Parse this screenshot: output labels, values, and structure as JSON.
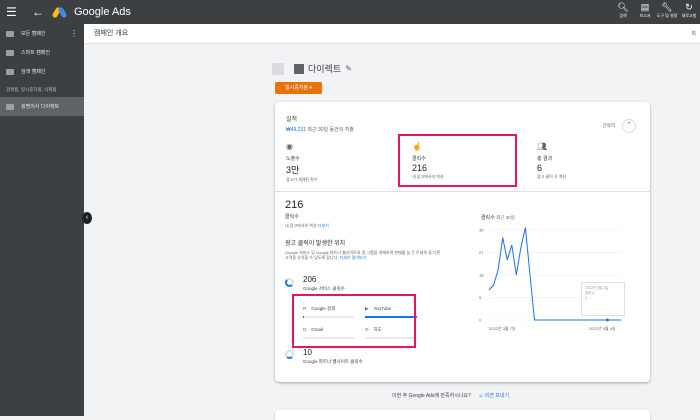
{
  "app": {
    "title": "Google Ads"
  },
  "colors": {
    "accent": "#1a73e8",
    "highlight": "#e8175d",
    "status": "#e8710a",
    "chrome": "#3c4043"
  },
  "toolbar": [
    {
      "icon": "search-icon",
      "label": "검색"
    },
    {
      "icon": "report-icon",
      "label": "보고서"
    },
    {
      "icon": "wrench-icon",
      "label": "도구 및 설정"
    },
    {
      "icon": "refresh-icon",
      "label": "새로고침"
    }
  ],
  "sidebar": {
    "items": [
      {
        "label": "모든 캠페인",
        "icon": "grid-icon"
      },
      {
        "label": "스마트 캠페인",
        "icon": "smart-campaign-icon"
      },
      {
        "label": "검색 캠페인",
        "icon": "search-campaign-icon"
      }
    ],
    "section_label": "검색됨, 일시중지됨, 삭제됨",
    "selected": {
      "label": "광명이사 다이렉트",
      "icon": "campaign-icon"
    }
  },
  "breadcrumb": {
    "title": "캠페인 개요",
    "more": "최"
  },
  "campaign": {
    "name": "다이렉트",
    "status": "일시중지됨"
  },
  "performance": {
    "title": "실적",
    "spend_value": "₩49,231",
    "spend_label": "최근 30일 동안의 지출",
    "simple_view": "간략히",
    "metrics": [
      {
        "icon": "eye-icon",
        "label": "노출수",
        "value": "3만",
        "sub": "광고가 게재된 횟수"
      },
      {
        "icon": "click-icon",
        "label": "클릭수",
        "value": "216",
        "sub": "내 광고에서의 액션"
      },
      {
        "icon": "people-icon",
        "label": "총 결과",
        "value": "6",
        "sub": "광고 클릭 후 액션"
      }
    ]
  },
  "detail": {
    "value": "216",
    "label": "클릭수",
    "sub": "내 광고에서의 액션",
    "sub_link": "더보기",
    "where_title": "광고 클릭이 발생한 위치",
    "where_desc": "Google 서비스 및 Google 파트너 웹사이트와 앱 그룹을 게재하여 판매를 늘 든 트래픽 중 다른 고객을 유치할 수 있도록 합니다.",
    "where_link": "자세히 알아보기",
    "google_value": "206",
    "google_label": "Google 서비스 클릭수",
    "partner_value": "10",
    "partner_label": "Google 파트너 웹사이트 클릭수",
    "services": [
      {
        "icon": "search-mini-icon",
        "label": "Google 검색",
        "fill": 0.02
      },
      {
        "icon": "youtube-icon",
        "label": "YouTube",
        "fill": 1.0
      },
      {
        "icon": "gmail-icon",
        "label": "Gmail",
        "fill": 0
      },
      {
        "icon": "maps-icon",
        "label": "지도",
        "fill": 0
      }
    ]
  },
  "chart_data": {
    "type": "line",
    "title": "클릭수",
    "subtitle": "최근 30일",
    "x": [
      0,
      1,
      2,
      3,
      4,
      5,
      6,
      7,
      8,
      9,
      10,
      11,
      12,
      13,
      14,
      15,
      16,
      17,
      18,
      19,
      20,
      21,
      22,
      23,
      24,
      25,
      26,
      27,
      28,
      29
    ],
    "values": [
      12,
      14,
      20,
      33,
      24,
      30,
      18,
      29,
      37,
      18,
      0,
      0,
      0,
      0,
      0,
      0,
      0,
      0,
      0,
      0,
      0,
      0,
      0,
      0,
      0,
      0,
      0,
      0,
      0,
      0
    ],
    "yticks": [
      "36",
      "27",
      "18",
      "9",
      "0"
    ],
    "ylim": [
      0,
      36
    ],
    "xticks": [
      "2022년 3월 7일",
      "2022년 5월 4일"
    ],
    "tooltip_date": "2022년 5월 4일",
    "tooltip_label": "클릭수",
    "tooltip_value": "0"
  },
  "footer": {
    "question": "이번 주 Google Ads에 만족하시나요?",
    "link": "의견 보내기"
  }
}
